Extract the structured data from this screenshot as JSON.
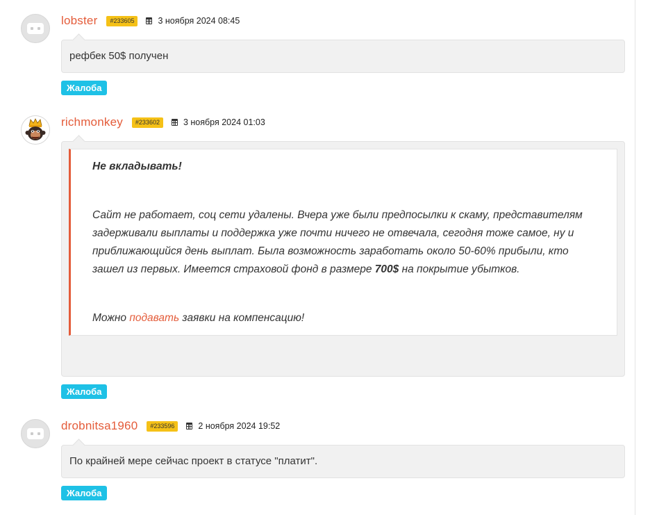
{
  "comments": [
    {
      "username": "lobster",
      "id_badge": "#233605",
      "date": "3 ноября 2024 08:45",
      "avatar": "robot-placeholder-icon",
      "text": "рефбек 50$ получен",
      "complaint_label": "Жалоба"
    },
    {
      "username": "richmonkey",
      "id_badge": "#233602",
      "date": "3 ноября 2024 01:03",
      "avatar": "monkey-king-icon",
      "quote": {
        "heading": "Не вкладывать!",
        "body_before_bold": "Сайт не работает, соц сети удалены. Вчера уже были предпосылки к скаму, представителям задерживали выплаты и поддержка уже почти ничего не отвечала, сегодня тоже самое, ну и приближающийся день выплат. Была возможность заработать около 50-60% прибыли, кто зашел из первых. Имеется страховой фонд в размере",
        "bold_amount": "700$",
        "body_after_bold": "на покрытие убытков.",
        "footer_before_link": "Можно",
        "footer_link": "подавать",
        "footer_after_link": "заявки на компенсацию!"
      },
      "complaint_label": "Жалоба"
    },
    {
      "username": "drobnitsa1960",
      "id_badge": "#233596",
      "date": "2 ноября 2024 19:52",
      "avatar": "robot-placeholder-icon",
      "text": "По крайней мере сейчас проект в статусе \"платит\".",
      "complaint_label": "Жалоба"
    }
  ],
  "colors": {
    "username": "#e45c3a",
    "id_badge": "#f5c117",
    "complaint_button": "#1ec1e6",
    "bubble_bg": "#f1f1f1",
    "quote_border": "#e45c3a"
  }
}
